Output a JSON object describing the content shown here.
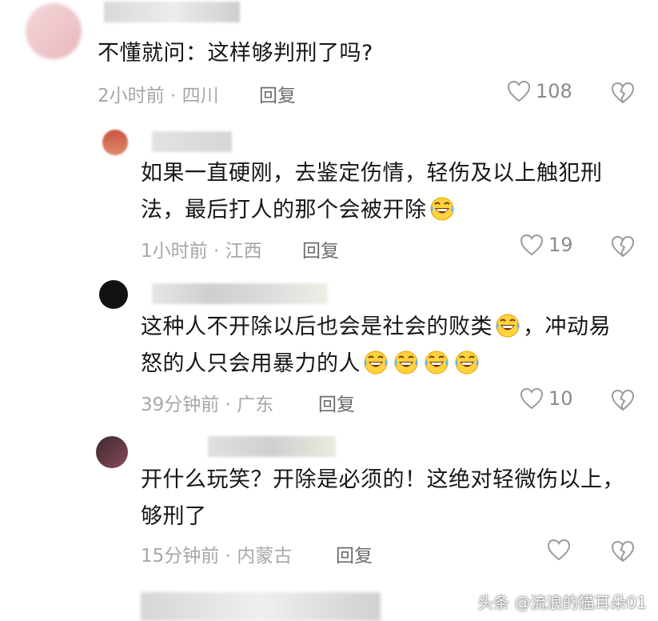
{
  "comments": [
    {
      "text": "不懂就问：这样够判刑了吗?",
      "meta": "2小时前 · 四川",
      "reply": "回复",
      "likes": "108"
    },
    {
      "text": "如果一直硬刚，去鉴定伤情，轻伤及以上触犯刑法，最后打人的那个会被开除",
      "meta": "1小时前 · 江西",
      "reply": "回复",
      "likes": "19"
    },
    {
      "text": "这种人不开除以后也会是社会的败类",
      "text2": "，冲动易怒的人只会用暴力的人",
      "meta": "39分钟前 · 广东",
      "reply": "回复",
      "likes": "10"
    },
    {
      "text": "开什么玩笑？开除是必须的！这绝对轻微伤以上，够刑了",
      "meta": "15分钟前 · 内蒙古",
      "reply": "回复",
      "likes": ""
    }
  ],
  "watermark": "头条 @流浪的猫耳朵01",
  "icons": {
    "like": "heart-outline-icon",
    "dislike": "broken-heart-icon",
    "emoji": "laugh-cry-emoji"
  }
}
